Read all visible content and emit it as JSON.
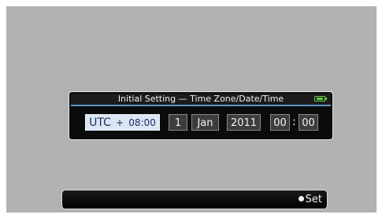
{
  "dialog": {
    "title": "Initial Setting — Time Zone/Date/Time",
    "battery_icon": "battery-icon",
    "timezone": {
      "prefix": "UTC",
      "sign": "+",
      "offset": "08:00"
    },
    "date": {
      "day": "1",
      "month": "Jan",
      "year": "2011"
    },
    "time": {
      "hour": "00",
      "separator": ":",
      "minute": "00"
    }
  },
  "footer": {
    "set_label": "Set",
    "set_icon": "bullet-icon"
  },
  "colors": {
    "background": "#b1b1b1",
    "selected_field": "#dde6f5",
    "title_underline": "#5a96c6",
    "battery": "#5fd23a"
  }
}
